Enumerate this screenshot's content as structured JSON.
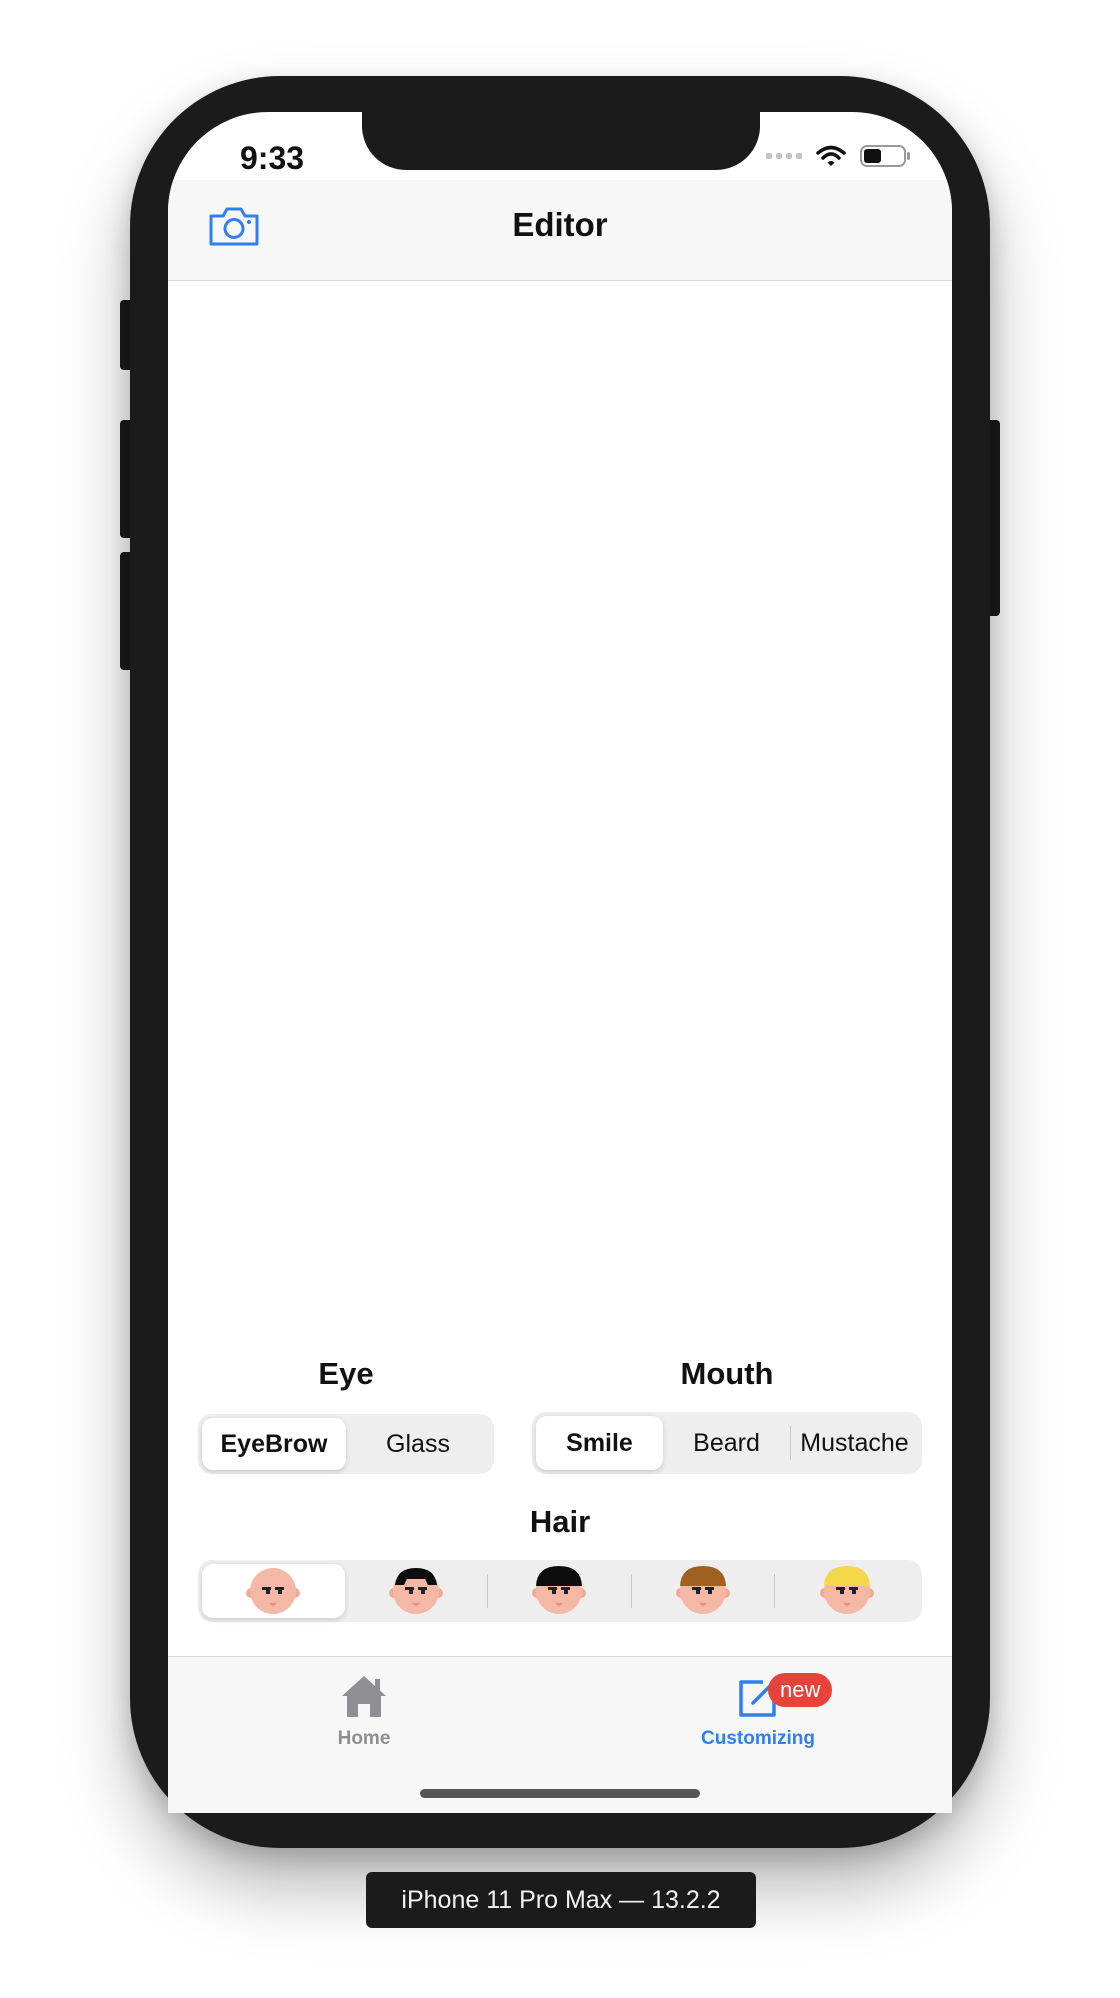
{
  "status_bar": {
    "time": "9:33"
  },
  "navbar": {
    "title": "Editor",
    "left_icon": "camera-icon"
  },
  "sections": {
    "eye": {
      "title": "Eye",
      "options": [
        "EyeBrow",
        "Glass"
      ],
      "selected": "EyeBrow"
    },
    "mouth": {
      "title": "Mouth",
      "options": [
        "Smile",
        "Beard",
        "Mustache"
      ],
      "selected": "Smile"
    },
    "hair": {
      "title": "Hair",
      "options": [
        "bald",
        "black-bangs",
        "black-bowl",
        "brown",
        "blonde"
      ],
      "selected": "bald",
      "colors": {
        "skin": "#f5b8a6",
        "black": "#0d0d0d",
        "brown": "#a0601f",
        "blonde": "#f5d84a"
      }
    }
  },
  "tabbar": {
    "items": [
      {
        "label": "Home",
        "icon": "house-icon"
      },
      {
        "label": "Customizing",
        "icon": "edit-icon",
        "badge": "new"
      }
    ],
    "selected": "Customizing"
  },
  "theme": {
    "accent": "#2f7ff0",
    "badge": "#e8433b"
  },
  "device_caption": "iPhone 11 Pro Max — 13.2.2"
}
